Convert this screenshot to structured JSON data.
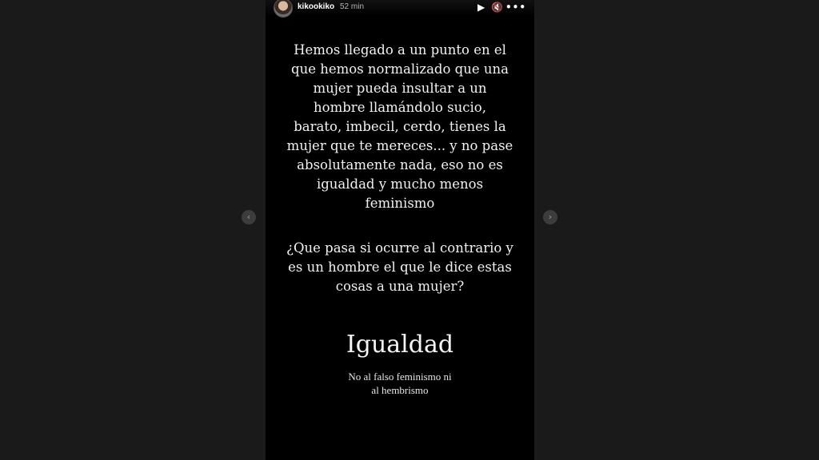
{
  "story": {
    "username": "kikookiko",
    "time": "52 min",
    "controls": {
      "play_icon": "play-icon",
      "mute_icon": "muted-speaker-icon",
      "more_icon": "more-options-icon",
      "play_glyph": "▶",
      "mute_glyph": "🔇",
      "more_glyph": "•••"
    },
    "paragraph1_lines": [
      "Hemos llegado a un punto en el",
      "que hemos normalizado que una",
      "mujer pueda insultar a un",
      "hombre llamándolo sucio,",
      "barato, imbecil, cerdo, tienes la",
      "mujer que te mereces... y no pase",
      "absolutamente nada, eso no es",
      "igualdad y mucho menos",
      "feminismo"
    ],
    "paragraph2_lines": [
      "¿Que pasa si ocurre al contrario y",
      "es un hombre el que le dice estas",
      "cosas a una mujer?"
    ],
    "heading": "Igualdad",
    "subtext_lines": [
      "No al falso feminismo ni",
      "al hembrismo"
    ]
  },
  "navigation": {
    "prev_glyph": "‹",
    "next_glyph": "›",
    "prev_icon": "chevron-left-icon",
    "next_icon": "chevron-right-icon"
  },
  "colors": {
    "backdrop": "#1a1a1a",
    "story_background": "#000000",
    "text": "#f2f2f2"
  }
}
